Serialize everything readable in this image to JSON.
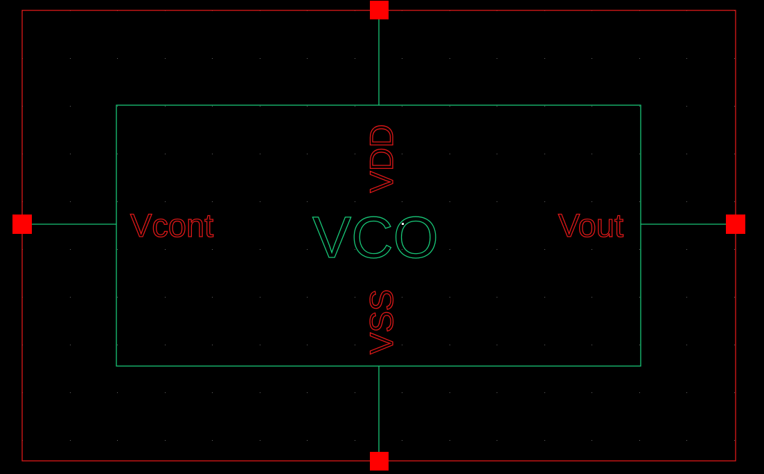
{
  "symbol": {
    "name": "VCO",
    "pins": {
      "top": "VDD",
      "bottom": "VSS",
      "left": "Vcont",
      "right": "Vout"
    }
  },
  "colors": {
    "background": "#000000",
    "bounding_box": "#e01818",
    "pin_marker": "#ff0000",
    "symbol_body": "#18c878",
    "pin_label": "#e01818",
    "grid_dot": "#6a6a6a",
    "cursor": "#ffffff"
  },
  "canvas": {
    "grid": true
  }
}
